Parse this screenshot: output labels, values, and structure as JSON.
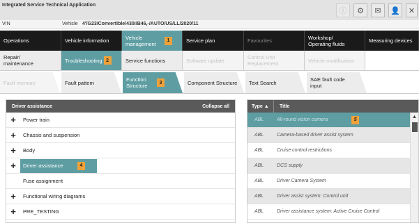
{
  "app": {
    "title": "Integrated Service Technical Application"
  },
  "toolbar": {
    "icons": [
      "info-icon",
      "settings-icon",
      "mail-icon",
      "user-icon",
      "close-icon"
    ]
  },
  "vehicle_bar": {
    "vin_label": "VIN",
    "vehicle_label": "Vehicle",
    "vehicle_value": "4'/G23/Convertible/430i/B46,-/AUTO/US/LL/2020/11"
  },
  "main_nav": [
    {
      "label": "Operations",
      "active": false
    },
    {
      "label": "Vehicle information",
      "active": false
    },
    {
      "label": "Vehicle management",
      "active": true,
      "badge": "1"
    },
    {
      "label": "Service plan",
      "active": false
    },
    {
      "label": "Favourites",
      "active": false,
      "dim": true
    },
    {
      "label": "Workshop/ Operating fluids",
      "active": false
    },
    {
      "label": "Measuring devices",
      "active": false
    }
  ],
  "sub_nav": [
    {
      "label": "Repair/ maintenance",
      "active": false
    },
    {
      "label": "Troubleshooting",
      "active": true,
      "badge": "2"
    },
    {
      "label": "Service functions",
      "active": false
    },
    {
      "label": "Software update",
      "active": false,
      "dim": true
    },
    {
      "label": "Control Unit Replacement",
      "active": false,
      "dim": true
    },
    {
      "label": "Vehicle modification",
      "active": false,
      "dim": true
    }
  ],
  "tabs": [
    {
      "label": "Fault memory",
      "active": false,
      "dim": true
    },
    {
      "label": "Fault pattern",
      "active": false
    },
    {
      "label": "Function Structure",
      "active": true,
      "badge": "3"
    },
    {
      "label": "Component Structure",
      "active": false
    },
    {
      "label": "Text Search",
      "active": false
    },
    {
      "label": "SAE fault code input",
      "active": false
    }
  ],
  "tree": {
    "header": "Driver assistance",
    "collapse_label": "Collapse all",
    "items": [
      {
        "label": "Power train",
        "expandable": true
      },
      {
        "label": "Chassis and suspension",
        "expandable": true
      },
      {
        "label": "Body",
        "expandable": true
      },
      {
        "label": "Driver assistance",
        "expandable": true,
        "selected": true,
        "badge": "4"
      },
      {
        "label": "Fuse assignment",
        "expandable": false
      },
      {
        "label": "Functional wiring diagrams",
        "expandable": true
      },
      {
        "label": "PRE_TESTING",
        "expandable": true
      }
    ]
  },
  "documents": {
    "col_type": "Type ▲",
    "col_title": "Title",
    "rows": [
      {
        "type": "ABL",
        "title": "All-round vision camera",
        "selected": true,
        "badge": "5"
      },
      {
        "type": "ABL",
        "title": "Camera-based driver assist system"
      },
      {
        "type": "ABL",
        "title": "Cruise control restrictions"
      },
      {
        "type": "ABL",
        "title": "DCS supply"
      },
      {
        "type": "ABL",
        "title": "Driver Camera System"
      },
      {
        "type": "ABL",
        "title": "Driver assist system: Control unit"
      },
      {
        "type": "ABL",
        "title": "Driver assistance system: Active Cruise Control"
      }
    ]
  },
  "colors": {
    "accent": "#5e9ea3",
    "badge": "#f0a23a",
    "nav_bg": "#1a1a1a",
    "header_bg": "#5a5a5a"
  }
}
